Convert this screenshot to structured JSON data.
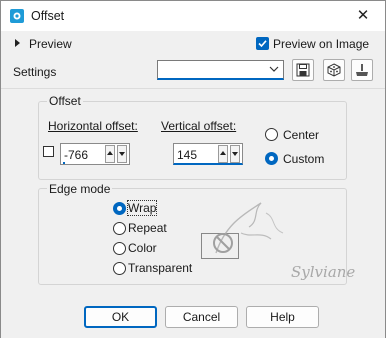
{
  "window": {
    "title": "Offset",
    "close_glyph": "✕"
  },
  "preview": {
    "label": "Preview"
  },
  "preview_on_image": {
    "label": "Preview on Image",
    "checked": true
  },
  "settings": {
    "label": "Settings",
    "value": ""
  },
  "offset_group": {
    "title": "Offset",
    "horizontal": {
      "label": "Horizontal offset:",
      "value": "-766"
    },
    "vertical": {
      "label": "Vertical offset:",
      "value": "145"
    },
    "center_label": "Center",
    "custom_label": "Custom",
    "selected": "Custom"
  },
  "edge_mode": {
    "title": "Edge mode",
    "options": [
      "Wrap",
      "Repeat",
      "Color",
      "Transparent"
    ],
    "selected": "Wrap"
  },
  "buttons": {
    "ok": "OK",
    "cancel": "Cancel",
    "help": "Help"
  },
  "watermark": {
    "text": "Sylviane"
  },
  "colors": {
    "accent": "#0067c0",
    "background": "#f0f0f0"
  },
  "icons": [
    "app-icon",
    "close-icon",
    "expand-arrow-icon",
    "checkmark-icon",
    "save-icon",
    "randomize-icon",
    "reset-icon"
  ]
}
